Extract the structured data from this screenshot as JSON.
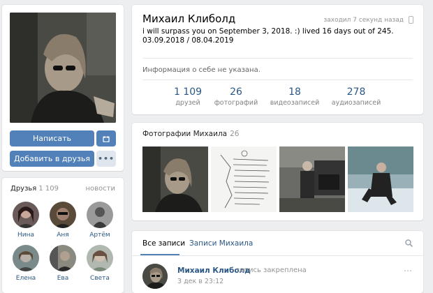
{
  "profile": {
    "name": "Михаил Клиболд",
    "last_seen": "заходил 7 секунд назад",
    "status": "i will surpass you on September 3, 2018. :) lived 16 days out of 245. 03.09.2018 / 08.04.2019",
    "info": "Информация о себе не указана."
  },
  "actions": {
    "message": "Написать сообщение",
    "gift_icon": "gift-icon",
    "add_friend": "Добавить в друзья",
    "more": "•••"
  },
  "counters": [
    {
      "value": "1 109",
      "label": "друзей"
    },
    {
      "value": "26",
      "label": "фотографий"
    },
    {
      "value": "18",
      "label": "видеозаписей"
    },
    {
      "value": "278",
      "label": "аудиозаписей"
    }
  ],
  "friends": {
    "title": "Друзья",
    "count": "1 109",
    "news": "новости",
    "items": [
      {
        "name": "Нина"
      },
      {
        "name": "Аня"
      },
      {
        "name": "Артём"
      },
      {
        "name": "Елена"
      },
      {
        "name": "Ева"
      },
      {
        "name": "Света"
      }
    ]
  },
  "photos": {
    "title": "Фотографии Михаила",
    "count": "26"
  },
  "wall": {
    "tabs": [
      "Все записи",
      "Записи Михаила"
    ],
    "post": {
      "author": "Михаил Клиболд",
      "pinned": "запись закреплена",
      "date": "3 дек в 23:12"
    }
  },
  "colors": {
    "accent": "#5181b8",
    "link": "#2a5885",
    "background": "#edeef0"
  }
}
